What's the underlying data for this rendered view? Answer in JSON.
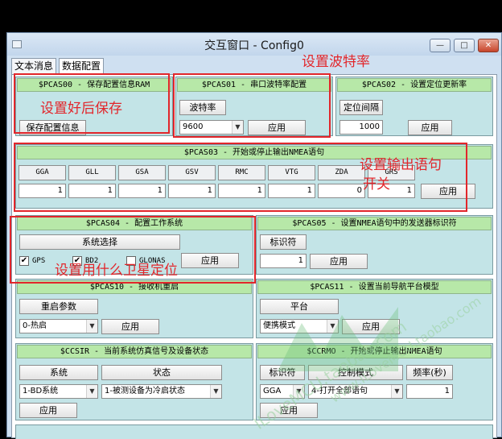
{
  "window": {
    "title": "交互窗口 - Config0",
    "buttons": {
      "minimize": "—",
      "maximize": "□",
      "close": "✕"
    }
  },
  "tabs": [
    {
      "label": "文本消息"
    },
    {
      "label": "数据配置"
    }
  ],
  "pcas00": {
    "header": "$PCAS00 - 保存配置信息RAM",
    "button": "保存配置信息"
  },
  "pcas01": {
    "header": "$PCAS01 - 串口波特率配置",
    "label": "波特率",
    "select": "9600",
    "apply": "应用"
  },
  "pcas02": {
    "header": "$PCAS02 - 设置定位更新率",
    "label": "定位间隔",
    "value": "1000",
    "apply": "应用"
  },
  "pcas03": {
    "header": "$PCAS03 - 开始或停止输出NMEA语句",
    "columns": [
      "GGA",
      "GLL",
      "GSA",
      "GSV",
      "RMC",
      "VTG",
      "ZDA",
      "GRS"
    ],
    "values": [
      "1",
      "1",
      "1",
      "1",
      "1",
      "1",
      "0",
      "1"
    ],
    "apply": "应用"
  },
  "pcas04": {
    "header": "$PCAS04 - 配置工作系统",
    "label": "系统选择",
    "options": [
      {
        "label": "GPS",
        "checked": "✔"
      },
      {
        "label": "BD2",
        "checked": "✔"
      },
      {
        "label": "GLONAS",
        "checked": ""
      }
    ],
    "apply": "应用"
  },
  "pcas05": {
    "header": "$PCAS05 - 设置NMEA语句中的发送器标识符",
    "label": "标识符",
    "value": "1",
    "apply": "应用"
  },
  "pcas10": {
    "header": "$PCAS10 - 接收机重启",
    "label": "重启参数",
    "select": "0-热启",
    "apply": "应用"
  },
  "pcas11": {
    "header": "$PCAS11 - 设置当前导航平台模型",
    "label": "平台",
    "select": "便携模式",
    "apply": "应用"
  },
  "ccsir": {
    "header": "$CCSIR - 当前系统仿真信号及设备状态",
    "col1": "系统",
    "col2": "状态",
    "select1": "1-BD系统",
    "select2": "1-被测设备为冷启状态",
    "apply": "应用"
  },
  "ccrmo": {
    "header": "$CCRMO - 开始或停止输出NMEA语句",
    "col1": "标识符",
    "col2": "控制模式",
    "col3": "频率(秒)",
    "select1": "GGA",
    "select2": "4-打开全部语句",
    "value": "1",
    "apply": "应用"
  },
  "annotations": {
    "baud": "设置波特率",
    "save": "设置好后保存",
    "output_line1": "设置输出语句",
    "output_line2": "开关",
    "satellite": "设置用什么卫星定位"
  },
  "watermark": {
    "text1": "ILoveMCU.taobao.com",
    "text2": "www.ILoveMCU.taobao.com"
  },
  "colors": {
    "panel_bg": "#c3e4e7",
    "header_bg": "#b7e8a8",
    "annotation": "#e2262b",
    "title_bar": "#cfe0f1"
  }
}
